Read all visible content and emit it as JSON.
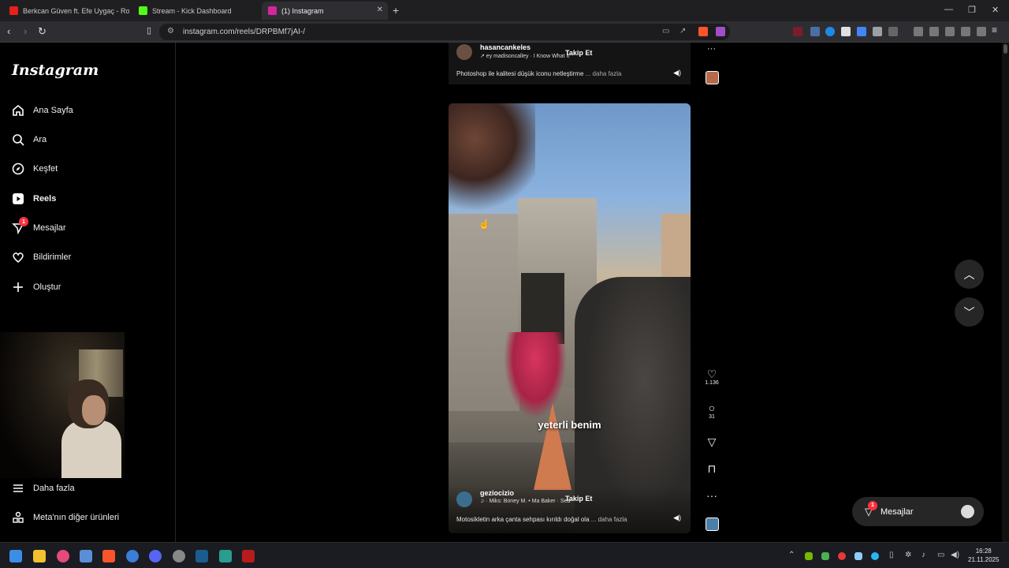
{
  "browser": {
    "tabs": [
      {
        "title": "Berkcan Güven ft. Efe Uygaç - Rockst...",
        "favicon_color": "#e62117"
      },
      {
        "title": "Stream - Kick Dashboard",
        "favicon_color": "#53fc18"
      },
      {
        "title": "(1) Instagram",
        "favicon_color": "#d6249f"
      }
    ],
    "url": "instagram.com/reels/DRPBMf7jAI-/",
    "new_tab_icon": "plus-icon"
  },
  "sidebar": {
    "logo": "Instagram",
    "nav": [
      {
        "label": "Ana Sayfa",
        "icon": "home-icon"
      },
      {
        "label": "Ara",
        "icon": "search-icon"
      },
      {
        "label": "Keşfet",
        "icon": "compass-icon"
      },
      {
        "label": "Reels",
        "icon": "reels-icon"
      },
      {
        "label": "Mesajlar",
        "icon": "messenger-icon",
        "badge": "1"
      },
      {
        "label": "Bildirimler",
        "icon": "heart-icon"
      },
      {
        "label": "Oluştur",
        "icon": "plus-icon"
      }
    ],
    "bottom": [
      {
        "label": "Daha fazla",
        "icon": "menu-icon"
      },
      {
        "label": "Meta'nın diğer ürünleri",
        "icon": "meta-apps-icon"
      }
    ]
  },
  "reel_prev": {
    "username": "hasancankeles",
    "audio": "↗ ey madisoncalley · I Know What It",
    "follow": "Takip Et",
    "caption": "Photoshop ile kalitesi düşük iconu netleştirme",
    "more": "... daha fazla"
  },
  "reel_main": {
    "subtitle": "yeterli benim",
    "username": "geziocizio",
    "audio": "♫ · Miks: Boney M. • Ma Baker · Sea",
    "follow": "Takip Et",
    "caption": "Motosikletin arka çanta sehpası kırıldı doğal ola",
    "more": "... daha fazla"
  },
  "actions": {
    "likes": "1.136",
    "comments": "31"
  },
  "floating_messages": {
    "label": "Mesajlar",
    "badge": "1"
  },
  "clock": {
    "time": "16:28",
    "date": "21.11.2025"
  }
}
